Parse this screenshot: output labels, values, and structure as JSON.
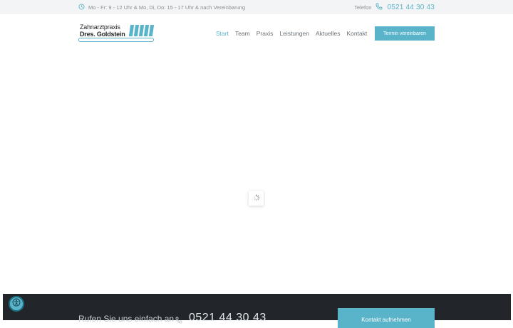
{
  "topbar": {
    "hours": "Mo - Fr: 9 - 12 Uhr & Mo, Di, Do: 15 - 17 Uhr & nach Vereinbarung",
    "phone_label": "Telefon",
    "phone_number": "0521 44 30 43"
  },
  "logo": {
    "line1": "Zahnarztpraxis",
    "line2": "Dres. Goldstein"
  },
  "nav": {
    "items": [
      {
        "label": "Start"
      },
      {
        "label": "Team"
      },
      {
        "label": "Praxis"
      },
      {
        "label": "Leistungen"
      },
      {
        "label": "Aktuelles"
      },
      {
        "label": "Kontakt"
      }
    ],
    "cta_label": "Termin vereinbaren"
  },
  "footer": {
    "call_text": "Rufen Sie uns einfach an",
    "phone_number": "0521 44 30 43",
    "contact_button": "Kontakt aufnehmen"
  },
  "icons": {
    "clock": "clock-icon",
    "phone": "phone-icon",
    "loader": "spinner-icon",
    "accessibility": "accessibility-icon"
  },
  "colors": {
    "accent": "#5ab4c9",
    "topbar_bg": "#f3f4f5",
    "footer_bg": "#22262b",
    "text_muted": "#8a8f94"
  }
}
